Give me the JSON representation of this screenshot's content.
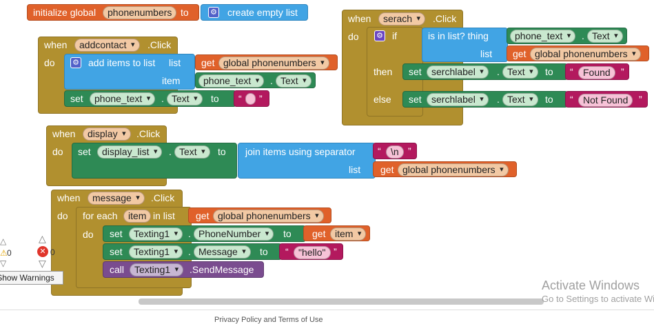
{
  "init_block": {
    "keyword": "initialize global",
    "var": "phonenumbers",
    "to": "to",
    "value": "create empty list"
  },
  "addcontact_block": {
    "when": "when",
    "component": "addcontact",
    "event": ".Click",
    "do": "do",
    "add_items": "add items to list",
    "list_label": "list",
    "item_label": "item",
    "get": "get",
    "get_var": "global phonenumbers",
    "phone_text": "phone_text",
    "text_prop": "Text",
    "set": "set",
    "to": "to",
    "empty_string": " "
  },
  "serach_block": {
    "when": "when",
    "component": "serach",
    "event": ".Click",
    "do": "do",
    "if": "if",
    "is_in_list": "is in list? thing",
    "list_label": "list",
    "phone_text": "phone_text",
    "text_prop": "Text",
    "get": "get",
    "get_var": "global phonenumbers",
    "then": "then",
    "else": "else",
    "set": "set",
    "label": "serchlabel",
    "to": "to",
    "found": "Found",
    "not_found": "Not Found"
  },
  "display_block": {
    "when": "when",
    "component": "display",
    "event": ".Click",
    "do": "do",
    "set": "set",
    "target": "display_list",
    "text_prop": "Text",
    "to": "to",
    "join": "join items using separator",
    "separator": "\\n",
    "list_label": "list",
    "get": "get",
    "get_var": "global phonenumbers"
  },
  "message_block": {
    "when": "when",
    "component": "message",
    "event": ".Click",
    "do": "do",
    "for_each": "for each",
    "item_var": "item",
    "in_list": "in list",
    "get": "get",
    "get_var": "global phonenumbers",
    "set": "set",
    "texting": "Texting1",
    "phone_prop": "PhoneNumber",
    "to": "to",
    "get_item": "item",
    "message_prop": "Message",
    "hello": "\"hello\"",
    "call": "call",
    "send": ".SendMessage"
  },
  "warnings": {
    "warning_count": "0",
    "error_count": "0",
    "toggle_label": "Show Warnings"
  },
  "watermark": {
    "line1": "Activate Windows",
    "line2": "Go to Settings to activate Windows."
  },
  "footer": {
    "text": "Privacy Policy and Terms of Use"
  }
}
